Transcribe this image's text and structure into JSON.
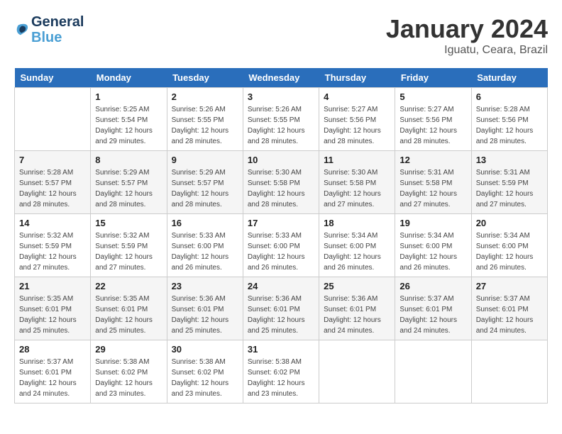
{
  "header": {
    "logo_line1": "General",
    "logo_line2": "Blue",
    "month_year": "January 2024",
    "location": "Iguatu, Ceara, Brazil"
  },
  "days_of_week": [
    "Sunday",
    "Monday",
    "Tuesday",
    "Wednesday",
    "Thursday",
    "Friday",
    "Saturday"
  ],
  "weeks": [
    [
      {
        "day": "",
        "empty": true
      },
      {
        "day": "1",
        "sunrise": "5:25 AM",
        "sunset": "5:54 PM",
        "daylight": "12 hours and 29 minutes."
      },
      {
        "day": "2",
        "sunrise": "5:26 AM",
        "sunset": "5:55 PM",
        "daylight": "12 hours and 28 minutes."
      },
      {
        "day": "3",
        "sunrise": "5:26 AM",
        "sunset": "5:55 PM",
        "daylight": "12 hours and 28 minutes."
      },
      {
        "day": "4",
        "sunrise": "5:27 AM",
        "sunset": "5:56 PM",
        "daylight": "12 hours and 28 minutes."
      },
      {
        "day": "5",
        "sunrise": "5:27 AM",
        "sunset": "5:56 PM",
        "daylight": "12 hours and 28 minutes."
      },
      {
        "day": "6",
        "sunrise": "5:28 AM",
        "sunset": "5:56 PM",
        "daylight": "12 hours and 28 minutes."
      }
    ],
    [
      {
        "day": "7",
        "sunrise": "5:28 AM",
        "sunset": "5:57 PM",
        "daylight": "12 hours and 28 minutes."
      },
      {
        "day": "8",
        "sunrise": "5:29 AM",
        "sunset": "5:57 PM",
        "daylight": "12 hours and 28 minutes."
      },
      {
        "day": "9",
        "sunrise": "5:29 AM",
        "sunset": "5:57 PM",
        "daylight": "12 hours and 28 minutes."
      },
      {
        "day": "10",
        "sunrise": "5:30 AM",
        "sunset": "5:58 PM",
        "daylight": "12 hours and 28 minutes."
      },
      {
        "day": "11",
        "sunrise": "5:30 AM",
        "sunset": "5:58 PM",
        "daylight": "12 hours and 27 minutes."
      },
      {
        "day": "12",
        "sunrise": "5:31 AM",
        "sunset": "5:58 PM",
        "daylight": "12 hours and 27 minutes."
      },
      {
        "day": "13",
        "sunrise": "5:31 AM",
        "sunset": "5:59 PM",
        "daylight": "12 hours and 27 minutes."
      }
    ],
    [
      {
        "day": "14",
        "sunrise": "5:32 AM",
        "sunset": "5:59 PM",
        "daylight": "12 hours and 27 minutes."
      },
      {
        "day": "15",
        "sunrise": "5:32 AM",
        "sunset": "5:59 PM",
        "daylight": "12 hours and 27 minutes."
      },
      {
        "day": "16",
        "sunrise": "5:33 AM",
        "sunset": "6:00 PM",
        "daylight": "12 hours and 26 minutes."
      },
      {
        "day": "17",
        "sunrise": "5:33 AM",
        "sunset": "6:00 PM",
        "daylight": "12 hours and 26 minutes."
      },
      {
        "day": "18",
        "sunrise": "5:34 AM",
        "sunset": "6:00 PM",
        "daylight": "12 hours and 26 minutes."
      },
      {
        "day": "19",
        "sunrise": "5:34 AM",
        "sunset": "6:00 PM",
        "daylight": "12 hours and 26 minutes."
      },
      {
        "day": "20",
        "sunrise": "5:34 AM",
        "sunset": "6:00 PM",
        "daylight": "12 hours and 26 minutes."
      }
    ],
    [
      {
        "day": "21",
        "sunrise": "5:35 AM",
        "sunset": "6:01 PM",
        "daylight": "12 hours and 25 minutes."
      },
      {
        "day": "22",
        "sunrise": "5:35 AM",
        "sunset": "6:01 PM",
        "daylight": "12 hours and 25 minutes."
      },
      {
        "day": "23",
        "sunrise": "5:36 AM",
        "sunset": "6:01 PM",
        "daylight": "12 hours and 25 minutes."
      },
      {
        "day": "24",
        "sunrise": "5:36 AM",
        "sunset": "6:01 PM",
        "daylight": "12 hours and 25 minutes."
      },
      {
        "day": "25",
        "sunrise": "5:36 AM",
        "sunset": "6:01 PM",
        "daylight": "12 hours and 24 minutes."
      },
      {
        "day": "26",
        "sunrise": "5:37 AM",
        "sunset": "6:01 PM",
        "daylight": "12 hours and 24 minutes."
      },
      {
        "day": "27",
        "sunrise": "5:37 AM",
        "sunset": "6:01 PM",
        "daylight": "12 hours and 24 minutes."
      }
    ],
    [
      {
        "day": "28",
        "sunrise": "5:37 AM",
        "sunset": "6:01 PM",
        "daylight": "12 hours and 24 minutes."
      },
      {
        "day": "29",
        "sunrise": "5:38 AM",
        "sunset": "6:02 PM",
        "daylight": "12 hours and 23 minutes."
      },
      {
        "day": "30",
        "sunrise": "5:38 AM",
        "sunset": "6:02 PM",
        "daylight": "12 hours and 23 minutes."
      },
      {
        "day": "31",
        "sunrise": "5:38 AM",
        "sunset": "6:02 PM",
        "daylight": "12 hours and 23 minutes."
      },
      {
        "day": "",
        "empty": true
      },
      {
        "day": "",
        "empty": true
      },
      {
        "day": "",
        "empty": true
      }
    ]
  ]
}
